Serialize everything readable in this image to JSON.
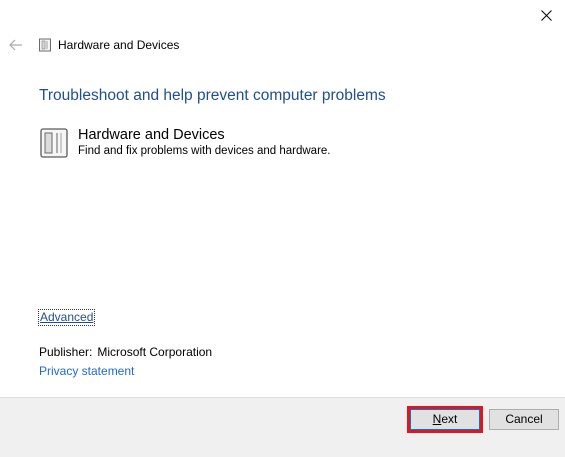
{
  "window": {
    "title": "Hardware and Devices"
  },
  "icons": {
    "close": "close-icon",
    "back": "back-arrow-icon",
    "title": "hardware-troubleshooter-icon",
    "item": "hardware-troubleshooter-icon"
  },
  "main": {
    "heading": "Troubleshoot and help prevent computer problems",
    "item": {
      "title": "Hardware and Devices",
      "description": "Find and fix problems with devices and hardware."
    },
    "advanced_label": "Advanced",
    "publisher_label": "Publisher:",
    "publisher_value": "Microsoft Corporation",
    "privacy_label": "Privacy statement"
  },
  "footer": {
    "next_label_mnemonic": "N",
    "next_label_rest": "ext",
    "cancel_label": "Cancel"
  },
  "colors": {
    "heading": "#1e4f8f",
    "link": "#1e6ad1",
    "highlight": "#e0161e",
    "footer_bg": "#f0f0f0"
  }
}
